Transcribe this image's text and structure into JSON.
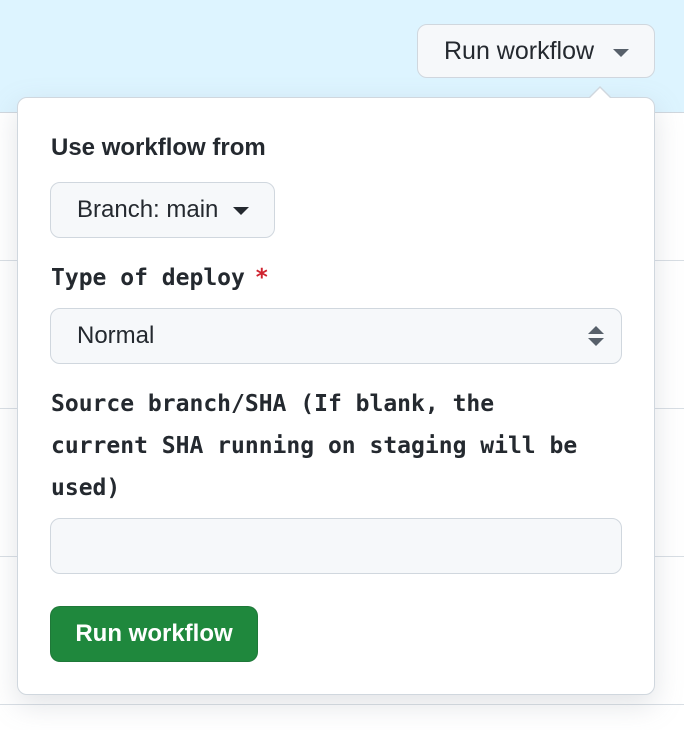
{
  "header": {
    "trigger_label": "Run workflow"
  },
  "popover": {
    "title": "Use workflow from",
    "branch_label": "Branch: main",
    "deploy_type": {
      "label": "Type of deploy",
      "required_marker": "*",
      "selected": "Normal"
    },
    "source": {
      "label_line1": "Source branch/SHA (If blank, the",
      "label_line2": "current SHA running on staging will be",
      "label_line3": "used)",
      "value": "",
      "placeholder": ""
    },
    "submit_label": "Run workflow"
  },
  "colors": {
    "header_band": "#ddf4ff",
    "submit_button": "#1f883d",
    "required_star": "#cf222e",
    "border": "#d0d7de"
  },
  "icons": {
    "trigger_caret": "chevron-down-icon",
    "branch_caret": "chevron-down-icon",
    "select_caret": "select-updown-icon"
  }
}
